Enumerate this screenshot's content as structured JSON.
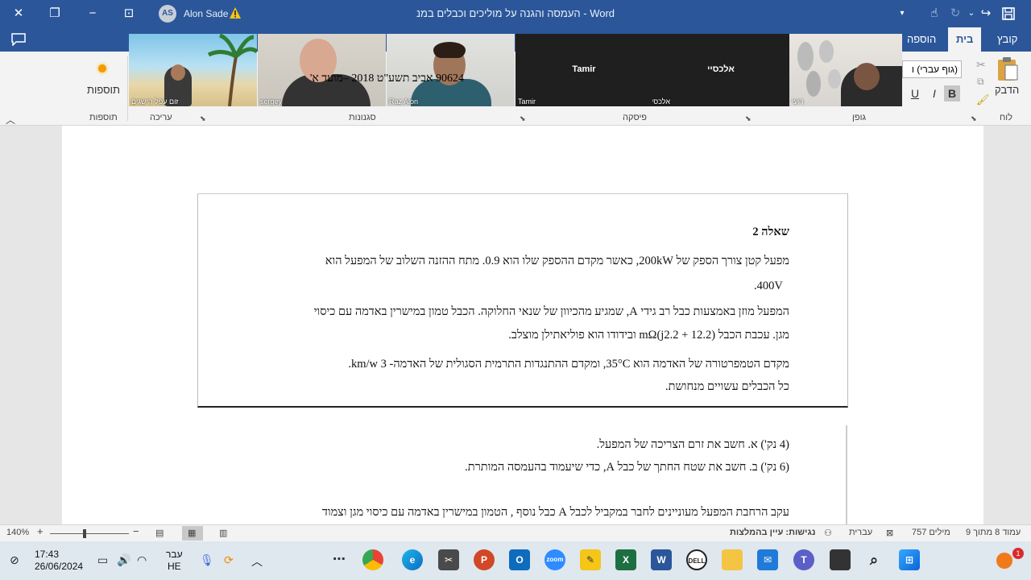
{
  "titlebar": {
    "doc_title": "העמסה והגנה על מוליכים וכבלים במנ  -  Word",
    "user_initials": "AS",
    "user_name": "Alon Sade"
  },
  "tabs": [
    "קובץ",
    "בית",
    "הוספה"
  ],
  "ribbon": {
    "groups": [
      "לוח",
      "גופן",
      "פיסקה",
      "סגנונות",
      "עריכה",
      "תוספות"
    ],
    "addins_label": "תוספות",
    "paste_label": "הדבק",
    "font_name": "(גוף עברי) ו",
    "format_buttons": [
      "B",
      "I",
      "U"
    ]
  },
  "participants": [
    {
      "name": "זום עפל הישגים",
      "center": ""
    },
    {
      "name": "sergey",
      "center": ""
    },
    {
      "name": "Raz Alon",
      "center": ""
    },
    {
      "name": "Tamir",
      "center": "Tamir"
    },
    {
      "name": "אלכסיי",
      "center": "אלכסיי"
    },
    {
      "name": "רועי",
      "center": ""
    }
  ],
  "document": {
    "header": "90624 אביב תשע\"ט 2018 –מועד א'",
    "question_title": "שאלה 2",
    "lines": [
      "מפעל קטן צורך הספק של 200kW, כאשר מקדם ההספק שלו הוא 0.9. מתח ההזנה השלוב של המפעל הוא",
      "400V.",
      "המפעל מוזן באמצעות כבל רב גידי A, שמגיע מהכיוון של שנאי החלוקה. הכבל טמון במישרין באדמה עם כיסוי",
      "מגן. עכבת הכבל (12.2 + j2.2)mΩ ובידודו הוא פוליאתילן מוצלב.",
      "מקדם הטמפרטורה של האדמה הוא 35°C, ומקדם ההתנגדות התרמית הסגולית של האדמה- 3 km/w.",
      "כל הכבלים עשויים מנחושת."
    ],
    "sub_items": [
      "(4 נק') א.  חשב את זרם הצריכה של המפעל.",
      "(6 נק') ב.  חשב את שטח החתך של כבל A, כדי שיעמוד בהעמסה המותרת."
    ],
    "last_line": "עקב הרחבת המפעל מעוניינים לחבר במקביל לכבל A כבל נוסף ,  הטמון במישרין באדמה עם כיסוי מגן וצמוד"
  },
  "statusbar": {
    "page": "עמוד 8 מתוך 9",
    "words": "757 מילים",
    "language": "עברית",
    "accessibility": "נגישות: עיין בהמלצות",
    "zoom": "140%"
  },
  "taskbar": {
    "time": "17:43",
    "date": "26/06/2024",
    "lang_top": "עבר",
    "lang_bottom": "HE",
    "notification_count": "1",
    "apps": [
      "explorer-dots",
      "chrome",
      "edge",
      "snip",
      "powerpoint",
      "outlook",
      "zoom",
      "pen",
      "excel",
      "word",
      "dell",
      "folder",
      "mail",
      "teams",
      "app",
      "search",
      "windows"
    ]
  }
}
